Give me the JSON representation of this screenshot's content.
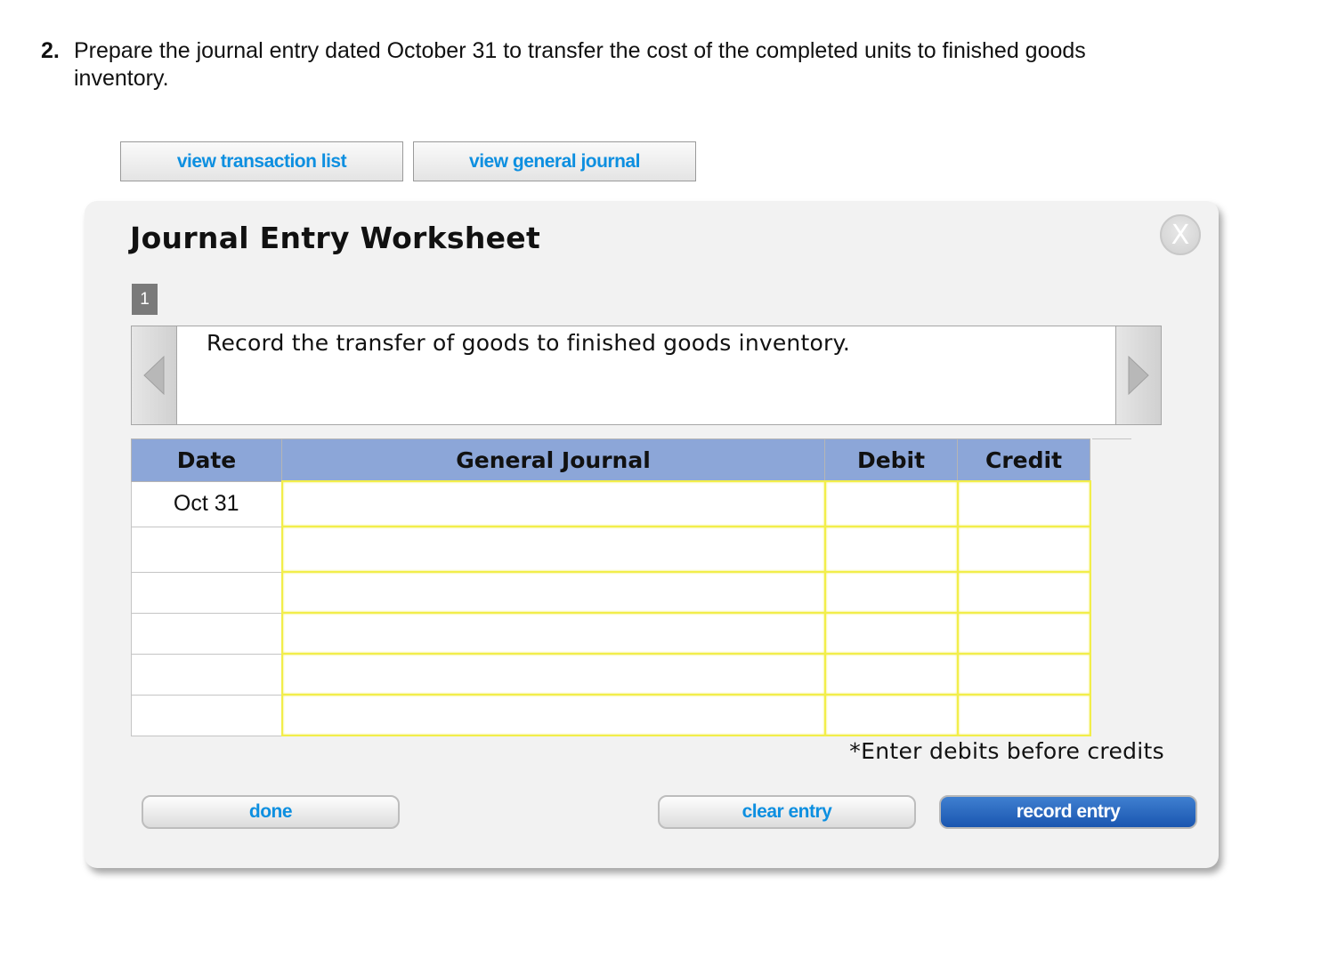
{
  "question": {
    "number": "2.",
    "text": "Prepare the journal entry dated October 31 to transfer the cost of the completed units to finished goods inventory."
  },
  "top_buttons": {
    "transaction_list": "view transaction list",
    "general_journal": "view general journal"
  },
  "worksheet": {
    "title": "Journal Entry Worksheet",
    "close_label": "X",
    "step_number": "1",
    "instruction": "Record the transfer of goods to finished goods inventory.",
    "nav_prev_icon": "triangle-left-icon",
    "nav_next_icon": "triangle-right-icon"
  },
  "table": {
    "headers": {
      "date": "Date",
      "general_journal": "General Journal",
      "debit": "Debit",
      "credit": "Credit"
    },
    "rows": [
      {
        "date": "Oct 31",
        "account": "",
        "debit": "",
        "credit": ""
      },
      {
        "date": "",
        "account": "",
        "debit": "",
        "credit": ""
      },
      {
        "date": "",
        "account": "",
        "debit": "",
        "credit": ""
      },
      {
        "date": "",
        "account": "",
        "debit": "",
        "credit": ""
      },
      {
        "date": "",
        "account": "",
        "debit": "",
        "credit": ""
      },
      {
        "date": "",
        "account": "",
        "debit": "",
        "credit": ""
      }
    ]
  },
  "footnote": "*Enter debits before credits",
  "actions": {
    "done": "done",
    "clear_entry": "clear entry",
    "record_entry": "record entry"
  },
  "colors": {
    "link_blue": "#0d8fe0",
    "header_blue": "#8ca6d8",
    "input_yellow": "#f2ee4a",
    "record_button": "#1f5fb8"
  }
}
